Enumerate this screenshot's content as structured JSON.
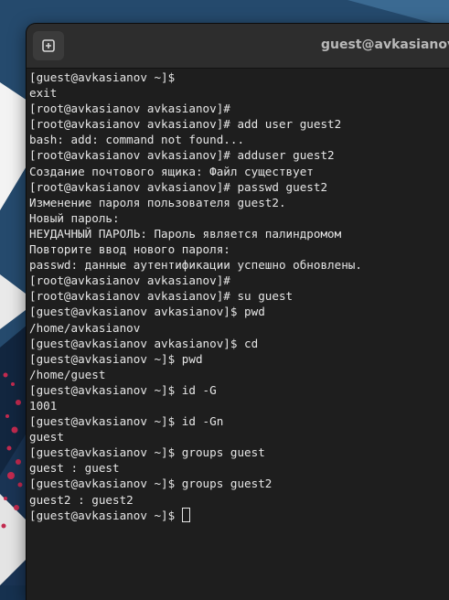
{
  "window": {
    "title": "guest@avkasianov:~"
  },
  "terminal": {
    "lines": [
      "[guest@avkasianov ~]$",
      "exit",
      "[root@avkasianov avkasianov]#",
      "[root@avkasianov avkasianov]# add user guest2",
      "bash: add: command not found...",
      "[root@avkasianov avkasianov]# adduser guest2",
      "Создание почтового ящика: Файл существует",
      "[root@avkasianov avkasianov]# passwd guest2",
      "Изменение пароля пользователя guest2.",
      "Новый пароль:",
      "НЕУДАЧНЫЙ ПАРОЛЬ: Пароль является палиндромом",
      "Повторите ввод нового пароля:",
      "passwd: данные аутентификации успешно обновлены.",
      "[root@avkasianov avkasianov]#",
      "[root@avkasianov avkasianov]# su guest",
      "[guest@avkasianov avkasianov]$ pwd",
      "/home/avkasianov",
      "[guest@avkasianov avkasianov]$ cd",
      "[guest@avkasianov ~]$ pwd",
      "/home/guest",
      "[guest@avkasianov ~]$ id -G",
      "1001",
      "[guest@avkasianov ~]$ id -Gn",
      "guest",
      "[guest@avkasianov ~]$ groups guest",
      "guest : guest",
      "[guest@avkasianov ~]$ groups guest2",
      "guest2 : guest2"
    ],
    "prompt": "[guest@avkasianov ~]$ "
  },
  "icons": {
    "new_tab": "new-tab-icon"
  },
  "colors": {
    "terminal_bg": "#1e1e1e",
    "headerbar_bg": "#2d2d2d",
    "text": "#e6e6e6",
    "wallpaper": "#16314f"
  }
}
